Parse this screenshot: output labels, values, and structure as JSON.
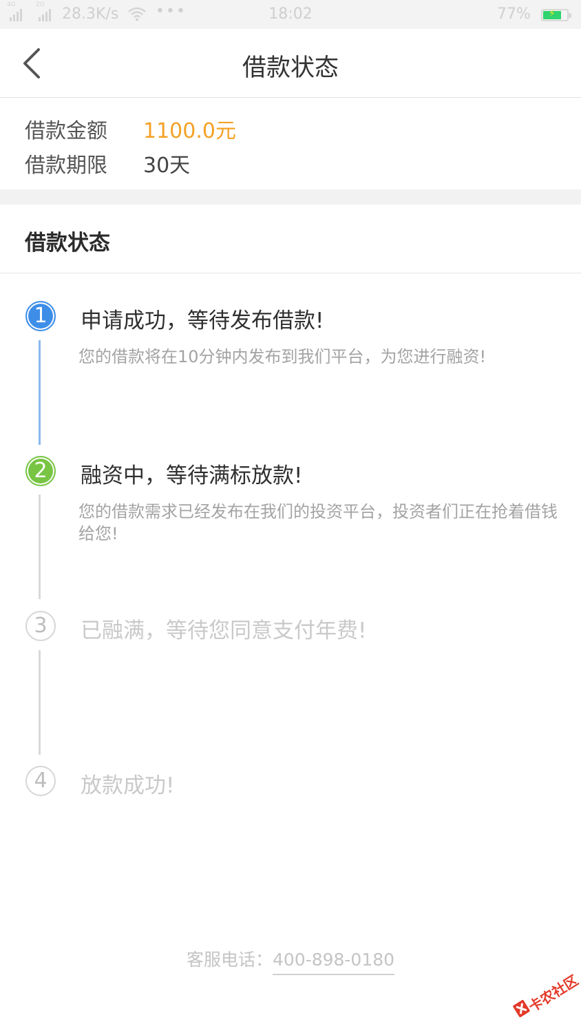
{
  "status_bar": {
    "net1": "4G",
    "net2": "2G",
    "speed": "28.3K/s",
    "dots": "•••",
    "time": "18:02",
    "battery": "77%",
    "battery_level": 0.77
  },
  "nav": {
    "title": "借款状态"
  },
  "loan": {
    "amount_label": "借款金额",
    "amount_value": "1100.0元",
    "term_label": "借款期限",
    "term_value": "30天"
  },
  "section": {
    "title": "借款状态"
  },
  "steps": [
    {
      "num": "1",
      "title": "申请成功，等待发布借款!",
      "desc": "您的借款将在10分钟内发布到我们平台，为您进行融资!",
      "state": "done"
    },
    {
      "num": "2",
      "title": "融资中，等待满标放款!",
      "desc": "您的借款需求已经发布在我们的投资平台，投资者们正在抢着借钱给您!",
      "state": "current"
    },
    {
      "num": "3",
      "title": "已融满，等待您同意支付年费!",
      "state": "pending"
    },
    {
      "num": "4",
      "title": "放款成功!",
      "state": "pending"
    }
  ],
  "footer": {
    "hotline_label": "客服电话：",
    "phone": "400-898-0180"
  },
  "watermark": {
    "text": "卡农社区"
  },
  "colors": {
    "accent_orange": "#f4a125",
    "step1_blue": "#3e8ee8",
    "step2_green": "#78c544",
    "pending_gray": "#d6d6d6"
  }
}
